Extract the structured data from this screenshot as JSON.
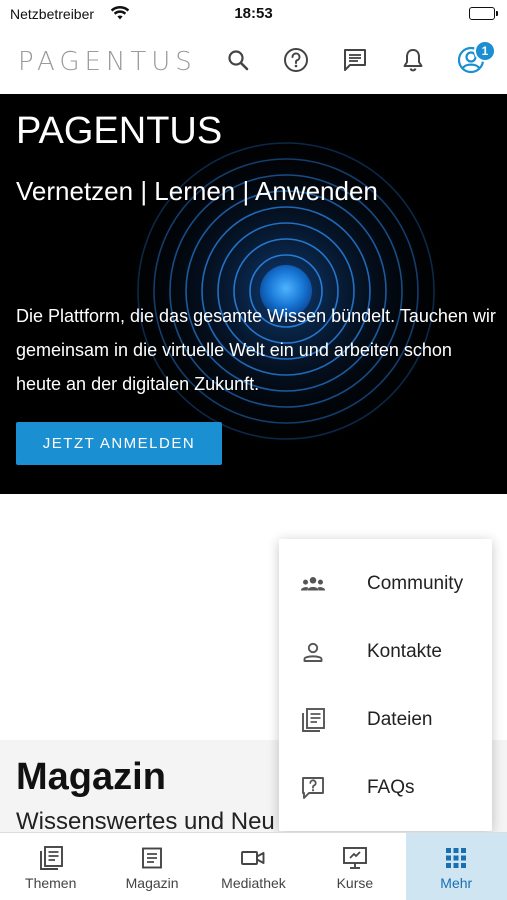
{
  "status_bar": {
    "carrier": "Netzbetreiber",
    "time": "18:53"
  },
  "header": {
    "logo": "PAGENTUS",
    "icons": [
      "search-icon",
      "help-icon",
      "chat-icon",
      "bell-icon",
      "profile-icon"
    ],
    "notification_count": "1"
  },
  "hero": {
    "title": "PAGENTUS",
    "subtitle": "Vernetzen | Lernen | Anwenden",
    "description": "Die Plattform, die das gesamte Wissen bündelt. Tauchen wir gemeinsam in die virtuelle Welt ein und arbeiten schon heute an der digitalen Zukunft.",
    "cta_label": "JETZT ANMELDEN"
  },
  "magazine": {
    "title": "Magazin",
    "subtitle": "Wissenswertes und Neu"
  },
  "more_menu": {
    "items": [
      {
        "label": "Community",
        "icon": "community-icon"
      },
      {
        "label": "Kontakte",
        "icon": "contact-icon"
      },
      {
        "label": "Dateien",
        "icon": "files-icon"
      },
      {
        "label": "FAQs",
        "icon": "faq-icon"
      }
    ]
  },
  "bottom_nav": {
    "items": [
      {
        "label": "Themen",
        "icon": "topics-icon"
      },
      {
        "label": "Magazin",
        "icon": "magazine-icon"
      },
      {
        "label": "Mediathek",
        "icon": "video-icon"
      },
      {
        "label": "Kurse",
        "icon": "courses-icon"
      },
      {
        "label": "Mehr",
        "icon": "grid-icon",
        "active": true
      }
    ]
  },
  "colors": {
    "accent": "#1a8fd1",
    "active_tab_bg": "#cfe5f2",
    "hero_bg": "#000000"
  }
}
